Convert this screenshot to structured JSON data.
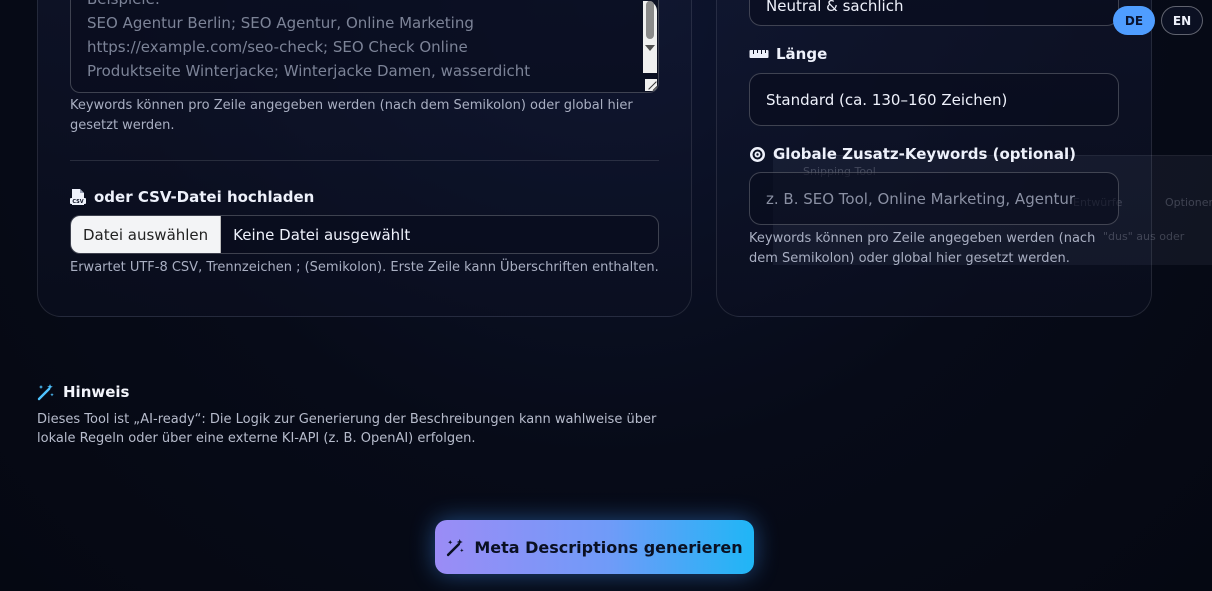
{
  "left_panel": {
    "keywords_textarea": {
      "lines": [
        "Beispiele:",
        "SEO Agentur Berlin; SEO Agentur, Online Marketing",
        "https://example.com/seo-check; SEO Check Online",
        "Produktseite Winterjacke; Winterjacke Damen, wasserdicht"
      ]
    },
    "keywords_help": "Keywords können pro Zeile angegeben werden (nach dem Semikolon) oder global hier gesetzt werden.",
    "csv_label": "oder CSV-Datei hochladen",
    "file_button": "Datei auswählen",
    "file_name": "Keine Datei ausgewählt",
    "csv_help": "Erwartet UTF-8 CSV, Trennzeichen ; (Semikolon). Erste Zeile kann Überschriften enthalten."
  },
  "right_panel": {
    "tone_value": "Neutral & sachlich",
    "length_label": "Länge",
    "length_value": "Standard (ca. 130–160 Zeichen)",
    "global_keywords_label": "Globale Zusatz-Keywords (optional)",
    "global_keywords_placeholder": "z. B. SEO Tool, Online Marketing, Agentur",
    "global_keywords_help": "Keywords können pro Zeile angegeben werden (nach dem Semikolon) oder global hier gesetzt werden."
  },
  "language": {
    "de": "DE",
    "en": "EN",
    "active": "DE"
  },
  "hint": {
    "title": "Hinweis",
    "text": "Dieses Tool ist „AI-ready“: Die Logik zur Generierung der Beschreibungen kann wahlweise über lokale Regeln oder über eine externe KI-API (z. B. OpenAI) erfolgen."
  },
  "generate_button": "Meta Descriptions generieren",
  "icons": {
    "csv": "csv-file-icon",
    "length": "ruler-icon",
    "keywords": "target-icon",
    "hint": "magic-wand-icon",
    "generate": "magic-wand-icon"
  },
  "colors": {
    "accent": "#4f9dff",
    "button_gradient_start": "#9b8cf6",
    "button_gradient_end": "#1fb6f6",
    "background": "#070b18"
  }
}
